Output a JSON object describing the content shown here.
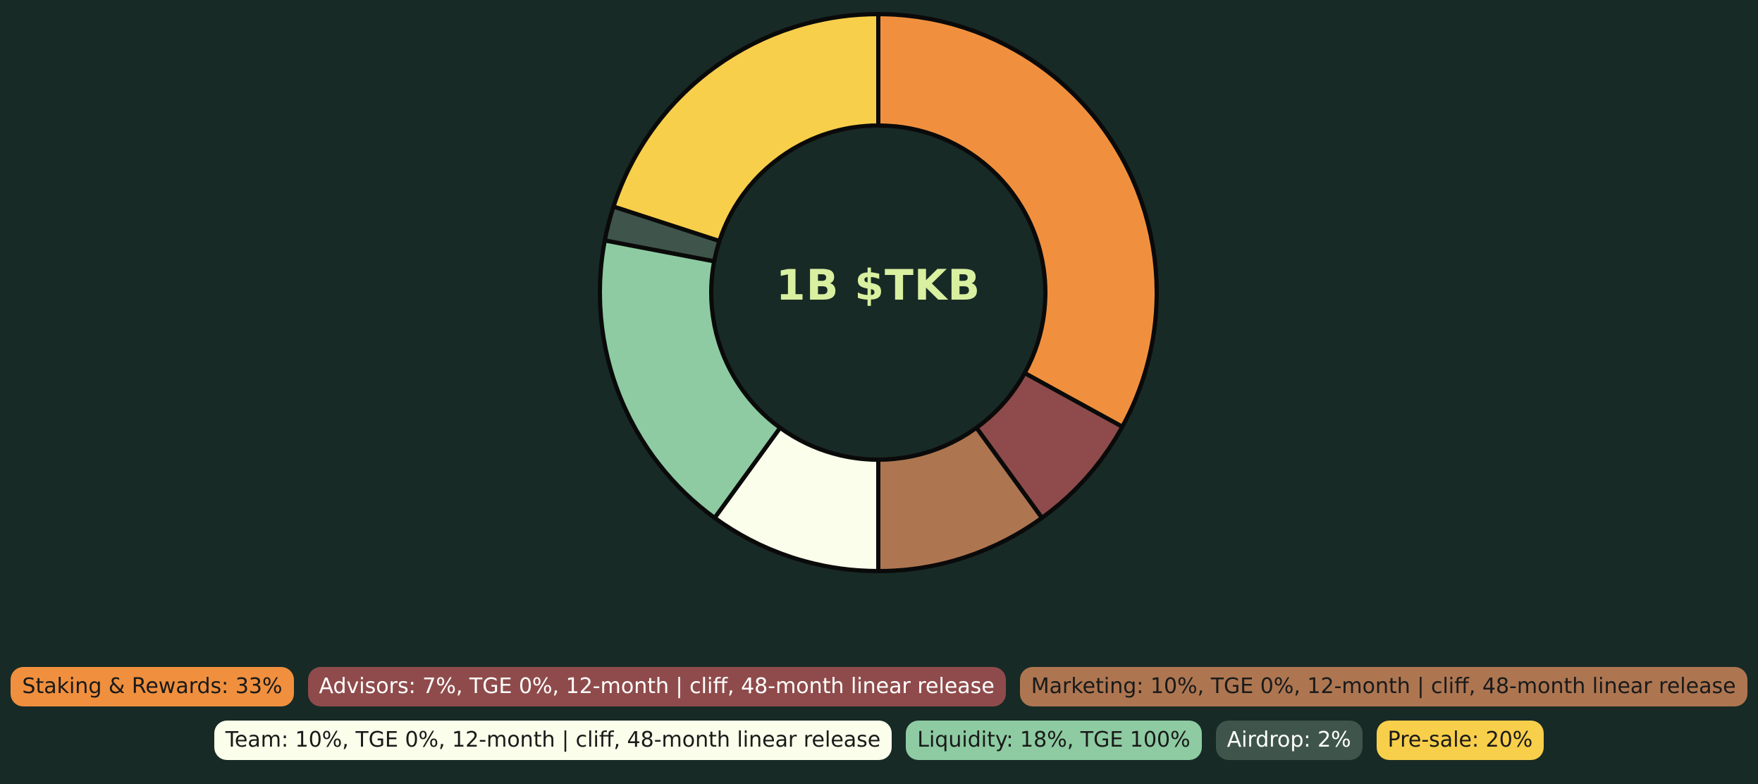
{
  "colors": {
    "background": "#182a25",
    "outline": "#0a0a0a",
    "center_text": "#d8f0a0"
  },
  "chart_data": {
    "type": "pie",
    "variant": "donut",
    "center_label": "1B $TKB",
    "slices": [
      {
        "name": "Staking & Rewards",
        "value": 33,
        "color": "#f0903e",
        "text_color": "#1a1a1a"
      },
      {
        "name": "Advisors",
        "value": 7,
        "color": "#8f4b4b",
        "text_color": "#ffffff"
      },
      {
        "name": "Marketing",
        "value": 10,
        "color": "#ad7651",
        "text_color": "#1a1a1a"
      },
      {
        "name": "Team",
        "value": 10,
        "color": "#fafeea",
        "text_color": "#1a1a1a"
      },
      {
        "name": "Liquidity",
        "value": 18,
        "color": "#8ecba2",
        "text_color": "#1a1a1a"
      },
      {
        "name": "Airdrop",
        "value": 2,
        "color": "#3f554c",
        "text_color": "#ffffff"
      },
      {
        "name": "Pre-sale",
        "value": 20,
        "color": "#f8cf4b",
        "text_color": "#1a1a1a"
      }
    ]
  },
  "legend": {
    "row1": [
      {
        "label": "Staking & Rewards: 33%"
      },
      {
        "label": "Advisors: 7%, TGE 0%, 12-month | cliff, 48-month linear release"
      },
      {
        "label": "Marketing: 10%, TGE 0%, 12-month | cliff, 48-month linear release"
      }
    ],
    "row2": [
      {
        "label": "Team: 10%, TGE 0%, 12-month | cliff, 48-month linear release"
      },
      {
        "label": "Liquidity: 18%, TGE 100%"
      },
      {
        "label": "Airdrop: 2%"
      },
      {
        "label": "Pre-sale: 20%"
      }
    ]
  }
}
